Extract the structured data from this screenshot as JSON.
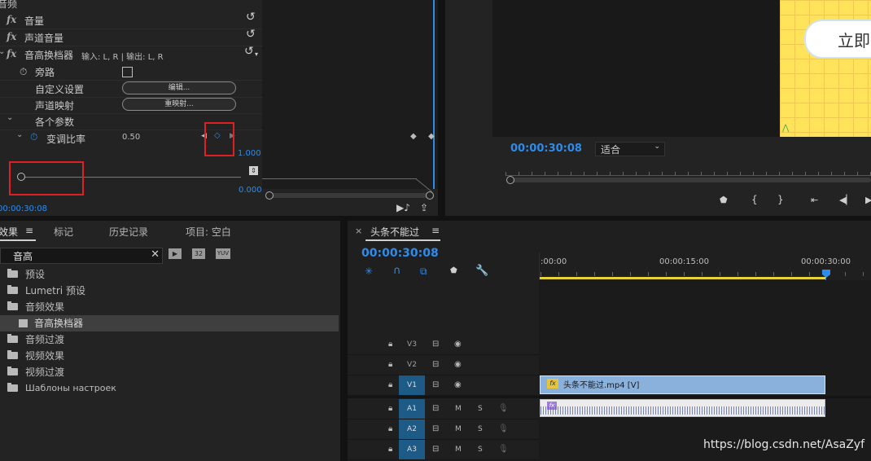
{
  "effect_controls": {
    "audio_header": "音频",
    "rows": [
      {
        "fx": "fx",
        "label": "音量"
      },
      {
        "fx": "fx",
        "label": "声道音量"
      },
      {
        "fx": "fx",
        "label": "音高换档器",
        "io": "输入: L, R | 输出: L, R"
      }
    ],
    "bypass_label": "旁路",
    "custom_setup_label": "自定义设置",
    "custom_setup_button": "编辑...",
    "channel_map_label": "声道映射",
    "channel_map_button": "重映射...",
    "params_label": "各个参数",
    "pitch_ratio_label": "变调比率",
    "pitch_ratio_value": "0.50",
    "graph_max": "1.000",
    "graph_min": "0.000",
    "timecode": "00:00:30:08"
  },
  "program_monitor": {
    "timecode": "00:00:30:08",
    "fit_label": "适合",
    "preview_text": "立即"
  },
  "effects_panel": {
    "tabs": [
      "效果",
      "标记",
      "历史记录",
      "项目: 空白"
    ],
    "search_value": "音高",
    "badge_32": "32",
    "badge_yuv": "YUV",
    "tree": [
      {
        "label": "预设",
        "kind": "star-folder"
      },
      {
        "label": "Lumetri 预设",
        "kind": "star-folder"
      },
      {
        "label": "音频效果",
        "kind": "folder-open"
      },
      {
        "label": "音高换档器",
        "kind": "effect",
        "selected": true
      },
      {
        "label": "音频过渡",
        "kind": "folder"
      },
      {
        "label": "视频效果",
        "kind": "folder"
      },
      {
        "label": "视频过渡",
        "kind": "folder"
      },
      {
        "label": "Шаблоны настроек",
        "kind": "star-folder"
      }
    ]
  },
  "timeline": {
    "close": "×",
    "sequence_name": "头条不能过",
    "timecode": "00:00:30:08",
    "ruler": [
      ":00:00",
      "00:00:15:00",
      "00:00:30:00"
    ],
    "video_tracks": [
      "V3",
      "V2",
      "V1"
    ],
    "audio_tracks": [
      "A1",
      "A2",
      "A3"
    ],
    "mute_label": "M",
    "solo_label": "S",
    "clip_name": "头条不能过.mp4 [V]",
    "fx_badge": "fx"
  },
  "watermark": "https://blog.csdn.net/AsaZyf",
  "colors": {
    "accent": "#2d8ceb",
    "clip_video": "#8ab0dc",
    "highlight": "#e02020"
  }
}
